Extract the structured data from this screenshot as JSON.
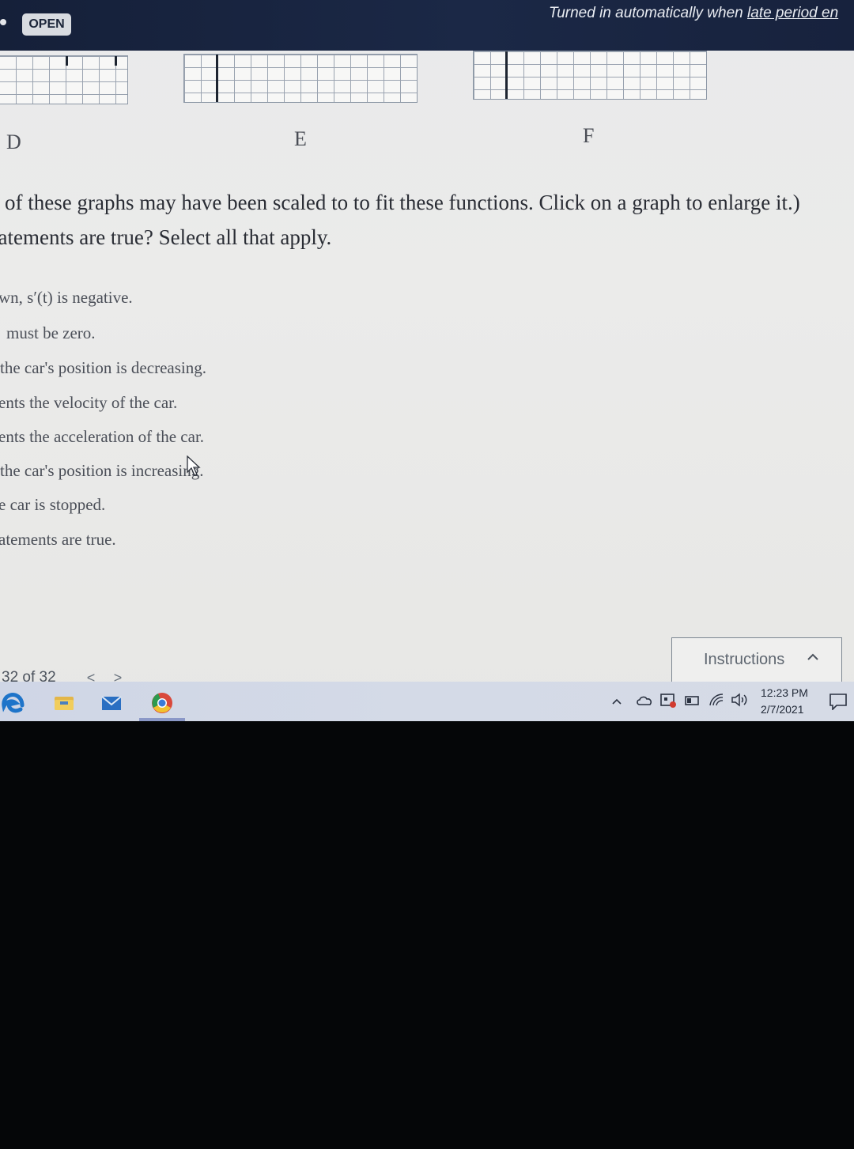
{
  "header": {
    "status_badge": "OPEN",
    "turned_in_prefix": "Turned in automatically when ",
    "turned_in_link": "late period en"
  },
  "graphs": {
    "labels": [
      "D",
      "E",
      "F"
    ]
  },
  "question": {
    "line1": "of these graphs may have been scaled to to fit these functions. Click on a graph to enlarge it.)",
    "line2": "tatements are true? Select all that apply."
  },
  "options": [
    "wn, s′(t) is negative.",
    "must be zero.",
    "the car's position is decreasing.",
    "ents the velocity of the car.",
    "ents the acceleration of the car.",
    "the car's position is increasing.",
    "e car is stopped.",
    "atements are true."
  ],
  "instructions": {
    "label": "Instructions"
  },
  "pager": {
    "count": "32 of 32",
    "prev": "<",
    "next": ">"
  },
  "taskbar": {
    "apps": [
      "edge-icon",
      "file-explorer-icon",
      "mail-icon",
      "chrome-icon"
    ],
    "tray": [
      "show-hidden-icons",
      "onedrive-icon",
      "network-icon",
      "battery-icon",
      "wifi-icon",
      "volume-icon"
    ],
    "clock_time": "12:23 PM",
    "clock_date": "2/7/2021"
  },
  "colors": {
    "header_bg": "#1b2846",
    "page_bg": "#ebebea",
    "taskbar_bg": "#d4dae7",
    "text": "#2a2d35"
  }
}
